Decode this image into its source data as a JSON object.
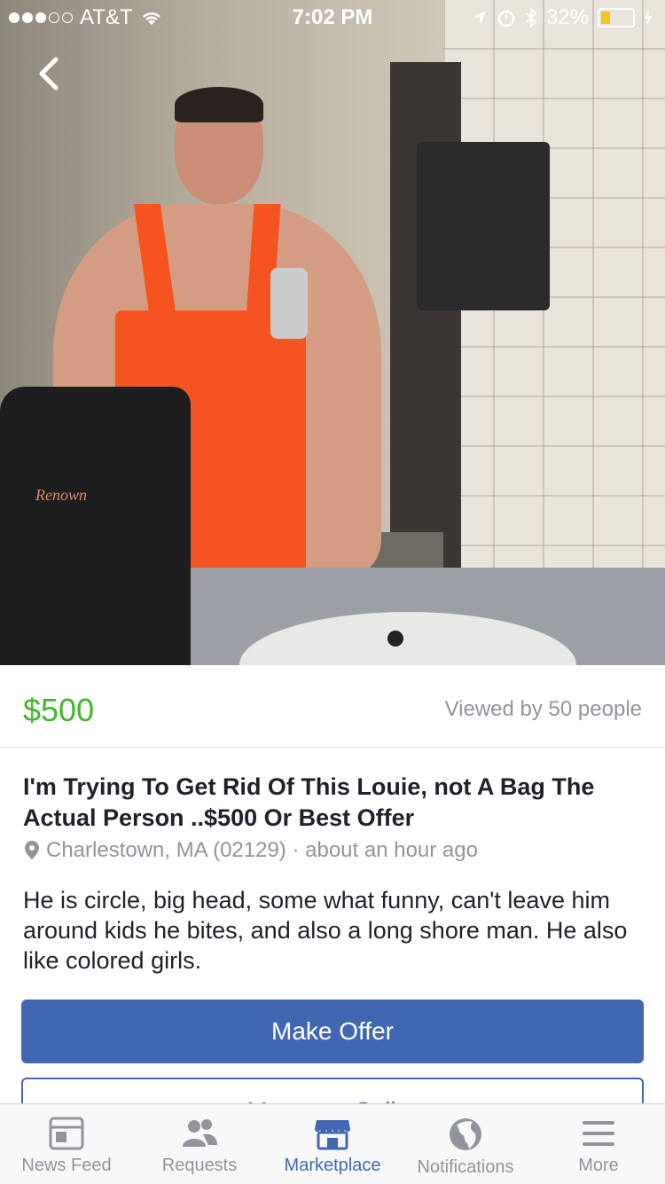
{
  "status_bar": {
    "carrier": "AT&T",
    "time": "7:02 PM",
    "battery": "32%",
    "battery_level": 0.32
  },
  "photo": {
    "sign_text": "Renown"
  },
  "listing": {
    "price": "$500",
    "views": "Viewed by 50 people",
    "title": "I'm Trying To Get Rid Of This Louie, not A Bag The Actual Person ..$500 Or Best Offer",
    "location": "Charlestown, MA (02129) · about an hour ago",
    "description": "He is  circle, big head, some what funny, can't leave him around kids he bites, and also a long shore man. He also like colored girls.",
    "primary_button": "Make Offer",
    "secondary_button": "Message Seller"
  },
  "tabs": [
    {
      "label": "News Feed",
      "icon": "news-feed-icon"
    },
    {
      "label": "Requests",
      "icon": "friend-requests-icon"
    },
    {
      "label": "Marketplace",
      "icon": "marketplace-icon",
      "active": true
    },
    {
      "label": "Notifications",
      "icon": "globe-icon"
    },
    {
      "label": "More",
      "icon": "menu-icon"
    }
  ],
  "colors": {
    "price_green": "#42b72a",
    "facebook_blue": "#4267b2",
    "muted_gray": "#90949c"
  }
}
